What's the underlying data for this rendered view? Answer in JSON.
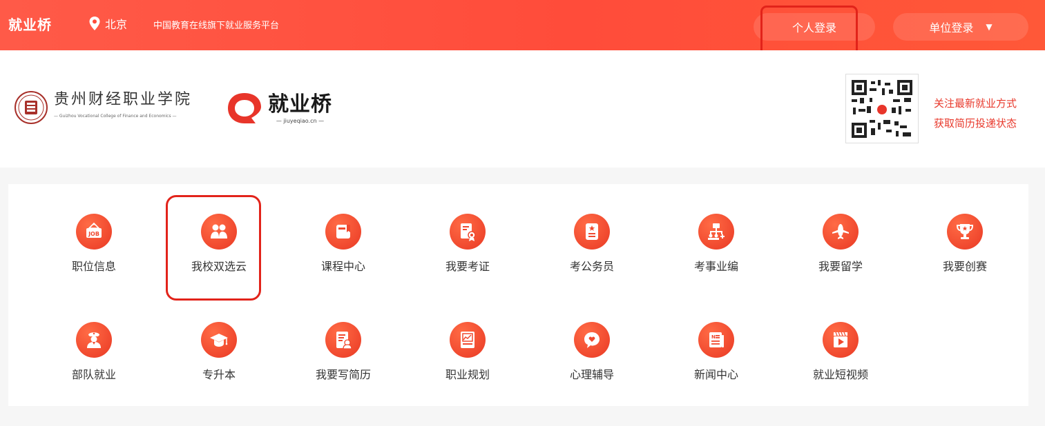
{
  "topbar": {
    "brand": "就业桥",
    "location": "北京",
    "slogan": "中国教育在线旗下就业服务平台",
    "personal_login": "个人登录",
    "unit_login": "单位登录",
    "unit_caret": "▼",
    "background_color": "#ff4c3a"
  },
  "header": {
    "college_cn": "贵州财经职业学院",
    "college_en": "— Guizhou Vocational College of Finance and Economics —",
    "jyq_cn": "就业桥",
    "jyq_en": "— jiuyeqiao.cn —",
    "qr_caption_line1": "关注最新就业方式",
    "qr_caption_line2": "获取简历投递状态",
    "accent_color": "#e8392c"
  },
  "services": {
    "row1": [
      {
        "label": "职位信息",
        "icon": "job-board-icon"
      },
      {
        "label": "我校双选云",
        "icon": "people-icon"
      },
      {
        "label": "课程中心",
        "icon": "book-icon"
      },
      {
        "label": "我要考证",
        "icon": "certificate-icon"
      },
      {
        "label": "考公务员",
        "icon": "document-star-icon"
      },
      {
        "label": "考事业编",
        "icon": "org-chart-icon"
      },
      {
        "label": "我要留学",
        "icon": "airplane-icon"
      },
      {
        "label": "我要创赛",
        "icon": "trophy-icon"
      }
    ],
    "row2": [
      {
        "label": "部队就业",
        "icon": "soldier-icon"
      },
      {
        "label": "专升本",
        "icon": "graduation-cap-icon"
      },
      {
        "label": "我要写简历",
        "icon": "resume-icon"
      },
      {
        "label": "职业规划",
        "icon": "chart-board-icon"
      },
      {
        "label": "心理辅导",
        "icon": "heart-chat-icon"
      },
      {
        "label": "新闻中心",
        "icon": "newspaper-icon"
      },
      {
        "label": "就业短视频",
        "icon": "video-icon"
      }
    ]
  }
}
